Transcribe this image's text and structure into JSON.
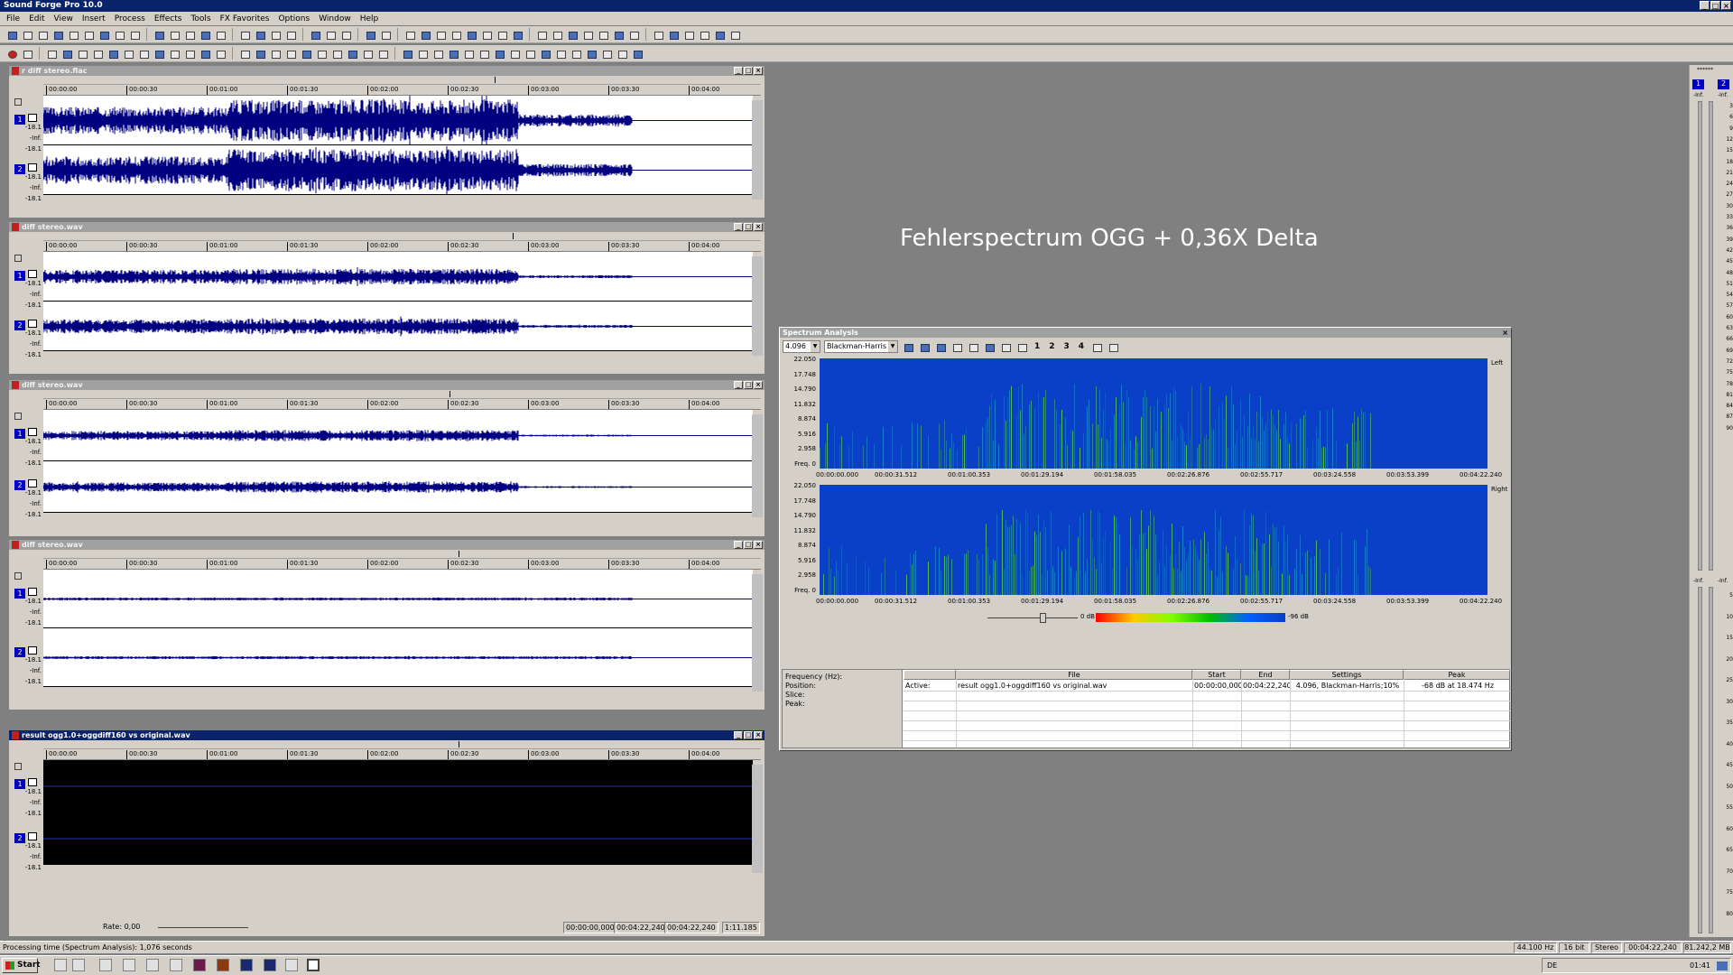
{
  "app": {
    "title": "Sound Forge Pro 10.0"
  },
  "menu": [
    "File",
    "Edit",
    "View",
    "Insert",
    "Process",
    "Effects",
    "Tools",
    "FX Favorites",
    "Options",
    "Window",
    "Help"
  ],
  "ruler_labels": [
    "00:00:00",
    "00:00:30",
    "00:01:00",
    "00:01:30",
    "00:02:00",
    "00:02:30",
    "00:03:00",
    "00:03:30",
    "00:04:00"
  ],
  "windows": [
    {
      "title": "r diff stereo.flac",
      "active": false,
      "db": [
        "-18.1",
        "-Inf.",
        "-18.1"
      ]
    },
    {
      "title": "diff stereo.wav",
      "active": false,
      "db": [
        "-18.1",
        "-Inf.",
        "-18.1"
      ]
    },
    {
      "title": "diff stereo.wav",
      "active": false,
      "db": [
        "-18.1",
        "-Inf.",
        "-18.1"
      ]
    },
    {
      "title": "diff stereo.wav",
      "active": false,
      "db": [
        "-18.1",
        "-Inf.",
        "-18.1"
      ]
    },
    {
      "title": "result ogg1.0+oggdiff160 vs original.wav",
      "active": true,
      "db": [
        "-18.1",
        "-Inf.",
        "-18.1"
      ]
    }
  ],
  "channel_numbers": [
    "1",
    "2"
  ],
  "active_window_footer": {
    "rate": "Rate: 0,00",
    "start": "00:00:00,000",
    "end": "00:04:22,240",
    "length": "00:04:22,240",
    "zoom": "1:11.185"
  },
  "overlay_caption": "Fehlerspectrum OGG + 0,36X Delta",
  "spectrum": {
    "title": "Spectrum Analysis",
    "fft_size": "4.096",
    "window_fn": "Blackman-Harris",
    "pages": [
      "1",
      "2",
      "3",
      "4"
    ],
    "freq_labels": [
      "22.050",
      "17.748",
      "14.790",
      "11.832",
      "8.874",
      "5.916",
      "2.958",
      "Freq. 0"
    ],
    "time_labels": [
      "00:00:00.000",
      "00:00:31.512",
      "00:01:00.353",
      "00:01:29.194",
      "00:01:58.035",
      "00:02:26.876",
      "00:02:55.717",
      "00:03:24.558",
      "00:03:53.399",
      "00:04:22.240"
    ],
    "channels": [
      "Left",
      "Right"
    ],
    "db_left": "0 dB",
    "db_right": "-96 dB",
    "info_labels": [
      "Frequency (Hz):",
      "Position:",
      "Slice:",
      "Peak:"
    ],
    "columns": [
      "File",
      "Start",
      "End",
      "Settings",
      "Peak"
    ],
    "row": {
      "label": "Active:",
      "file": "result ogg1.0+oggdiff160 vs original.wav",
      "start": "00:00:00,000",
      "end": "00:04:22,240",
      "settings": "4.096, Blackman-Harris;10%",
      "peak": "-68 dB at 18.474 Hz"
    }
  },
  "meters": {
    "top": "******",
    "channels": [
      "1",
      "2"
    ],
    "scale_top": [
      "-Inf.",
      "-Inf."
    ],
    "scale": [
      "3",
      "6",
      "9",
      "12",
      "15",
      "18",
      "21",
      "24",
      "27",
      "30",
      "33",
      "36",
      "39",
      "42",
      "45",
      "48",
      "51",
      "54",
      "57",
      "60",
      "63",
      "66",
      "69",
      "72",
      "75",
      "78",
      "81",
      "84",
      "87",
      "90"
    ],
    "scale2": [
      "-Inf.",
      "-Inf."
    ],
    "scale_bottom": [
      "5",
      "10",
      "15",
      "20",
      "25",
      "30",
      "35",
      "40",
      "45",
      "50",
      "55",
      "60",
      "65",
      "70",
      "75",
      "80"
    ]
  },
  "status": {
    "text": "Processing time (Spectrum Analysis): 1,076 seconds",
    "sample_rate": "44.100 Hz",
    "bits": "16 bit",
    "channels": "Stereo",
    "length": "00:04:22,240",
    "size": "81.242,2 MB"
  },
  "taskbar": {
    "start": "Start",
    "lang": "DE",
    "time": "01:41"
  }
}
